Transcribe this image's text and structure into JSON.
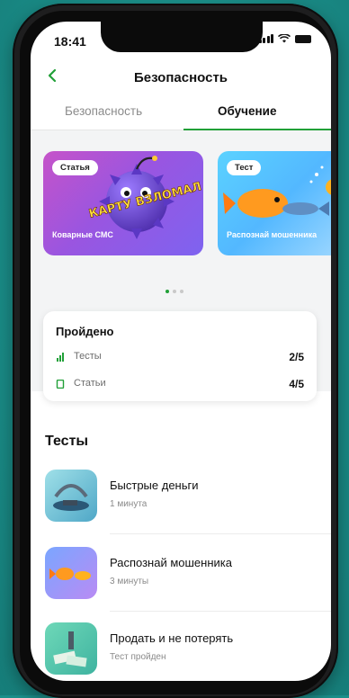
{
  "status_bar": {
    "time": "18:41"
  },
  "nav": {
    "title": "Безопасность"
  },
  "tabs": [
    {
      "label": "Безопасность",
      "active": false
    },
    {
      "label": "Обучение",
      "active": true
    }
  ],
  "carousel": {
    "cards": [
      {
        "badge": "Статья",
        "caption": "Коварные СМС",
        "art_text": "КАРТУ ВЗЛОМАЛ"
      },
      {
        "badge": "Тест",
        "caption": "Распознай мошенника"
      }
    ],
    "page_count": 3,
    "active_page": 1
  },
  "progress": {
    "title": "Пройдено",
    "rows": [
      {
        "label": "Тесты",
        "value": "2/5"
      },
      {
        "label": "Статьи",
        "value": "4/5"
      }
    ]
  },
  "tests_section": {
    "title": "Тесты",
    "items": [
      {
        "name": "Быстрые деньги",
        "sub": "1 минута"
      },
      {
        "name": "Распознай мошенника",
        "sub": "3 минуты"
      },
      {
        "name": "Продать и не потерять",
        "sub": "Тест пройден"
      }
    ]
  },
  "colors": {
    "accent": "#21a038",
    "background": "#1b8f8a"
  }
}
